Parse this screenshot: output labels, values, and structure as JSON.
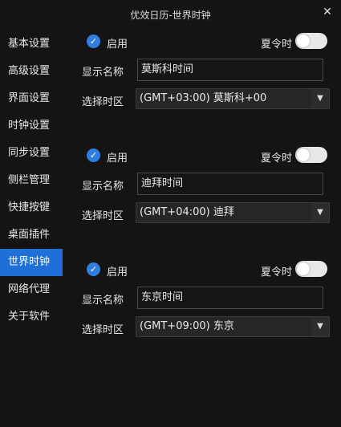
{
  "window": {
    "title": "优效日历-世界时钟",
    "close_glyph": "✕"
  },
  "sidebar": {
    "items": [
      {
        "label": "基本设置",
        "active": false
      },
      {
        "label": "高级设置",
        "active": false
      },
      {
        "label": "界面设置",
        "active": false
      },
      {
        "label": "时钟设置",
        "active": false
      },
      {
        "label": "同步设置",
        "active": false
      },
      {
        "label": "侧栏管理",
        "active": false
      },
      {
        "label": "快捷按键",
        "active": false
      },
      {
        "label": "桌面插件",
        "active": false
      },
      {
        "label": "世界时钟",
        "active": true
      },
      {
        "label": "网络代理",
        "active": false
      },
      {
        "label": "关于软件",
        "active": false
      }
    ]
  },
  "clocks": [
    {
      "enable_label": "启用",
      "enabled": true,
      "dst_label": "夏令时",
      "dst_on": false,
      "name_label": "显示名称",
      "name_value": "莫斯科时间",
      "zone_label": "选择时区",
      "zone_value": "(GMT+03:00)  莫斯科+00"
    },
    {
      "enable_label": "启用",
      "enabled": true,
      "dst_label": "夏令时",
      "dst_on": false,
      "name_label": "显示名称",
      "name_value": "迪拜时间",
      "zone_label": "选择时区",
      "zone_value": "(GMT+04:00)  迪拜"
    },
    {
      "enable_label": "启用",
      "enabled": true,
      "dst_label": "夏令时",
      "dst_on": false,
      "name_label": "显示名称",
      "name_value": "东京时间",
      "zone_label": "选择时区",
      "zone_value": "(GMT+09:00)  东京"
    }
  ],
  "icons": {
    "check": "check-icon",
    "dropdown": "triangle-down-icon",
    "close": "close-icon"
  },
  "colors": {
    "background": "#141414",
    "accent": "#1e6fd8",
    "checkbox": "#2f7ee0"
  }
}
